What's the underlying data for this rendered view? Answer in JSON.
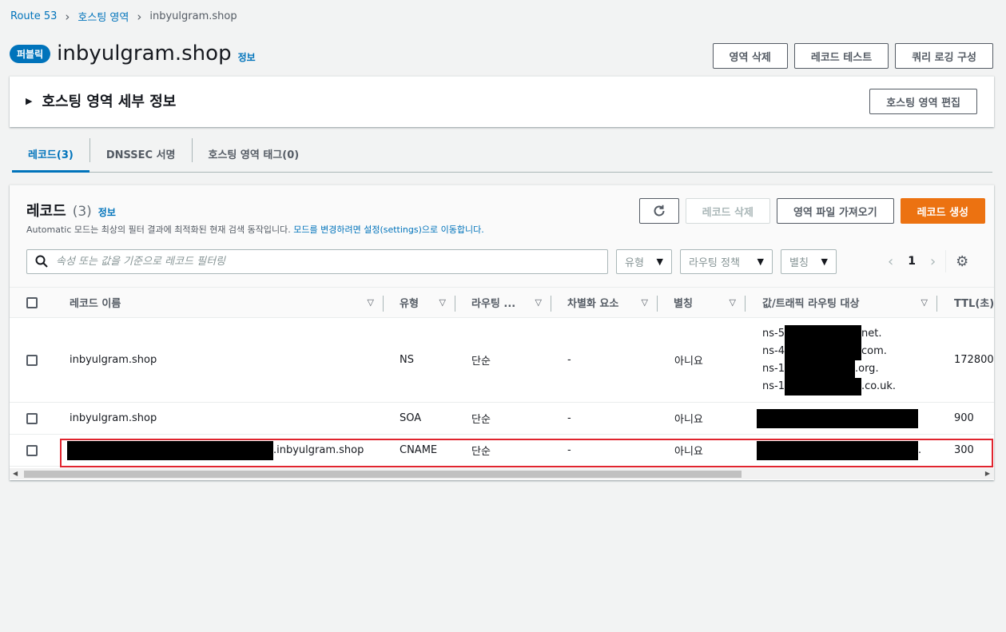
{
  "breadcrumb": {
    "root": "Route 53",
    "hosted_zones": "호스팅 영역",
    "current": "inbyulgram.shop"
  },
  "header": {
    "badge": "퍼블릭",
    "title": "inbyulgram.shop",
    "info": "정보",
    "actions": {
      "delete_zone": "영역 삭제",
      "test_record": "레코드 테스트",
      "query_logging": "쿼리 로깅 구성"
    }
  },
  "details": {
    "title": "호스팅 영역 세부 정보",
    "edit": "호스팅 영역 편집"
  },
  "tabs": [
    {
      "label": "레코드(3)"
    },
    {
      "label": "DNSSEC 서명"
    },
    {
      "label": "호스팅 영역 태그(0)"
    }
  ],
  "records": {
    "title": "레코드",
    "count": "(3)",
    "info": "정보",
    "desc_prefix": "Automatic 모드는 최상의 필터 결과에 최적화된 현재 검색 동작입니다. ",
    "desc_link": "모드를 변경하려면 설정(settings)으로 이동합니다.",
    "actions": {
      "delete": "레코드 삭제",
      "import": "영역 파일 가져오기",
      "create": "레코드 생성"
    },
    "search_placeholder": "속성 또는 값을 기준으로 레코드 필터링",
    "filters": {
      "type": "유형",
      "routing": "라우팅 정책",
      "alias": "별칭"
    },
    "page": "1"
  },
  "table": {
    "columns": [
      "레코드 이름",
      "유형",
      "라우팅 ...",
      "차별화 요소",
      "별칭",
      "값/트래픽 라우팅 대상",
      "TTL(초)"
    ],
    "rows": [
      {
        "name": "inbyulgram.shop",
        "type": "NS",
        "routing": "단순",
        "diff": "-",
        "alias": "아니요",
        "values": [
          "ns-5",
          "net.",
          "ns-4",
          "com.",
          "ns-1",
          ".org.",
          "ns-1",
          ".co.uk."
        ],
        "ttl": "172800"
      },
      {
        "name": "inbyulgram.shop",
        "type": "SOA",
        "routing": "단순",
        "diff": "-",
        "alias": "아니요",
        "ttl": "900"
      },
      {
        "name_suffix": ".inbyulgram.shop",
        "type": "CNAME",
        "routing": "단순",
        "diff": "-",
        "alias": "아니요",
        "value_suffix": ".",
        "ttl": "300"
      }
    ]
  }
}
